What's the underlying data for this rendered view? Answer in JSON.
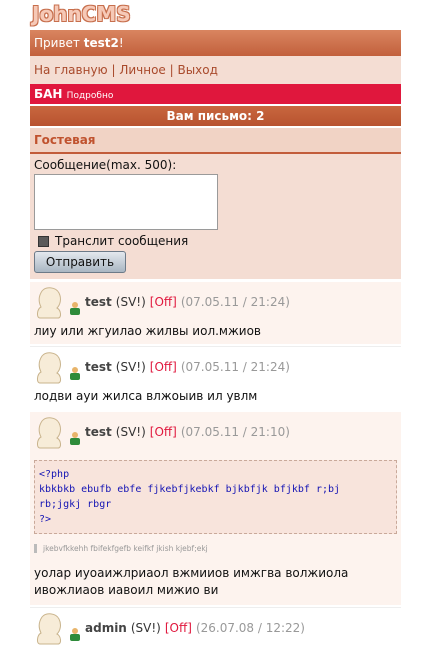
{
  "logo": "JohnCMS",
  "greeting": {
    "prefix": "Привет ",
    "user": "test2",
    "suffix": "!"
  },
  "nav": {
    "home": "На главную",
    "sep1": " | ",
    "personal": "Личное",
    "sep2": " | ",
    "exit": "Выход"
  },
  "ban": {
    "label": "БАН",
    "details": "Подробно"
  },
  "mail": "Вам письмо: 2",
  "guestbook_title": "Гостевая",
  "form": {
    "label": "Сообщение(max. 500):",
    "translit": "Транслит сообщения",
    "submit": "Отправить",
    "message": ""
  },
  "posts": [
    {
      "user": "test",
      "sv": "(SV!)",
      "off": "[Off]",
      "time": "(07.05.11 / 21:24)",
      "text": "лиу или жгуилао жилвы иол.мжиов"
    },
    {
      "user": "test",
      "sv": "(SV!)",
      "off": "[Off]",
      "time": "(07.05.11 / 21:24)",
      "text": "лодви ауи жилса влжоыив ил увлм"
    },
    {
      "user": "test",
      "sv": "(SV!)",
      "off": "[Off]",
      "time": "(07.05.11 / 21:10)",
      "code": [
        "<?php",
        "kbkbkb ebufb ebfe fjkebfjkebkf bjkbfjk bfjkbf r;bj",
        "rb;jgkj rbgr",
        "?>"
      ],
      "quote": "jkebvfkkehh fbifekfgefb keifkf jkish kjebf;ekj",
      "text": "уолар иуоаижлриаол вжмииов имжгва волжиола ивожлиаов иавоил мижио ви"
    },
    {
      "user": "admin",
      "sv": "(SV!)",
      "off": "[Off]",
      "time": "(26.07.08 / 12:22)"
    }
  ],
  "colors": {
    "header": "#c96a46",
    "ban": "#e0173d",
    "accent": "#c0522e"
  }
}
